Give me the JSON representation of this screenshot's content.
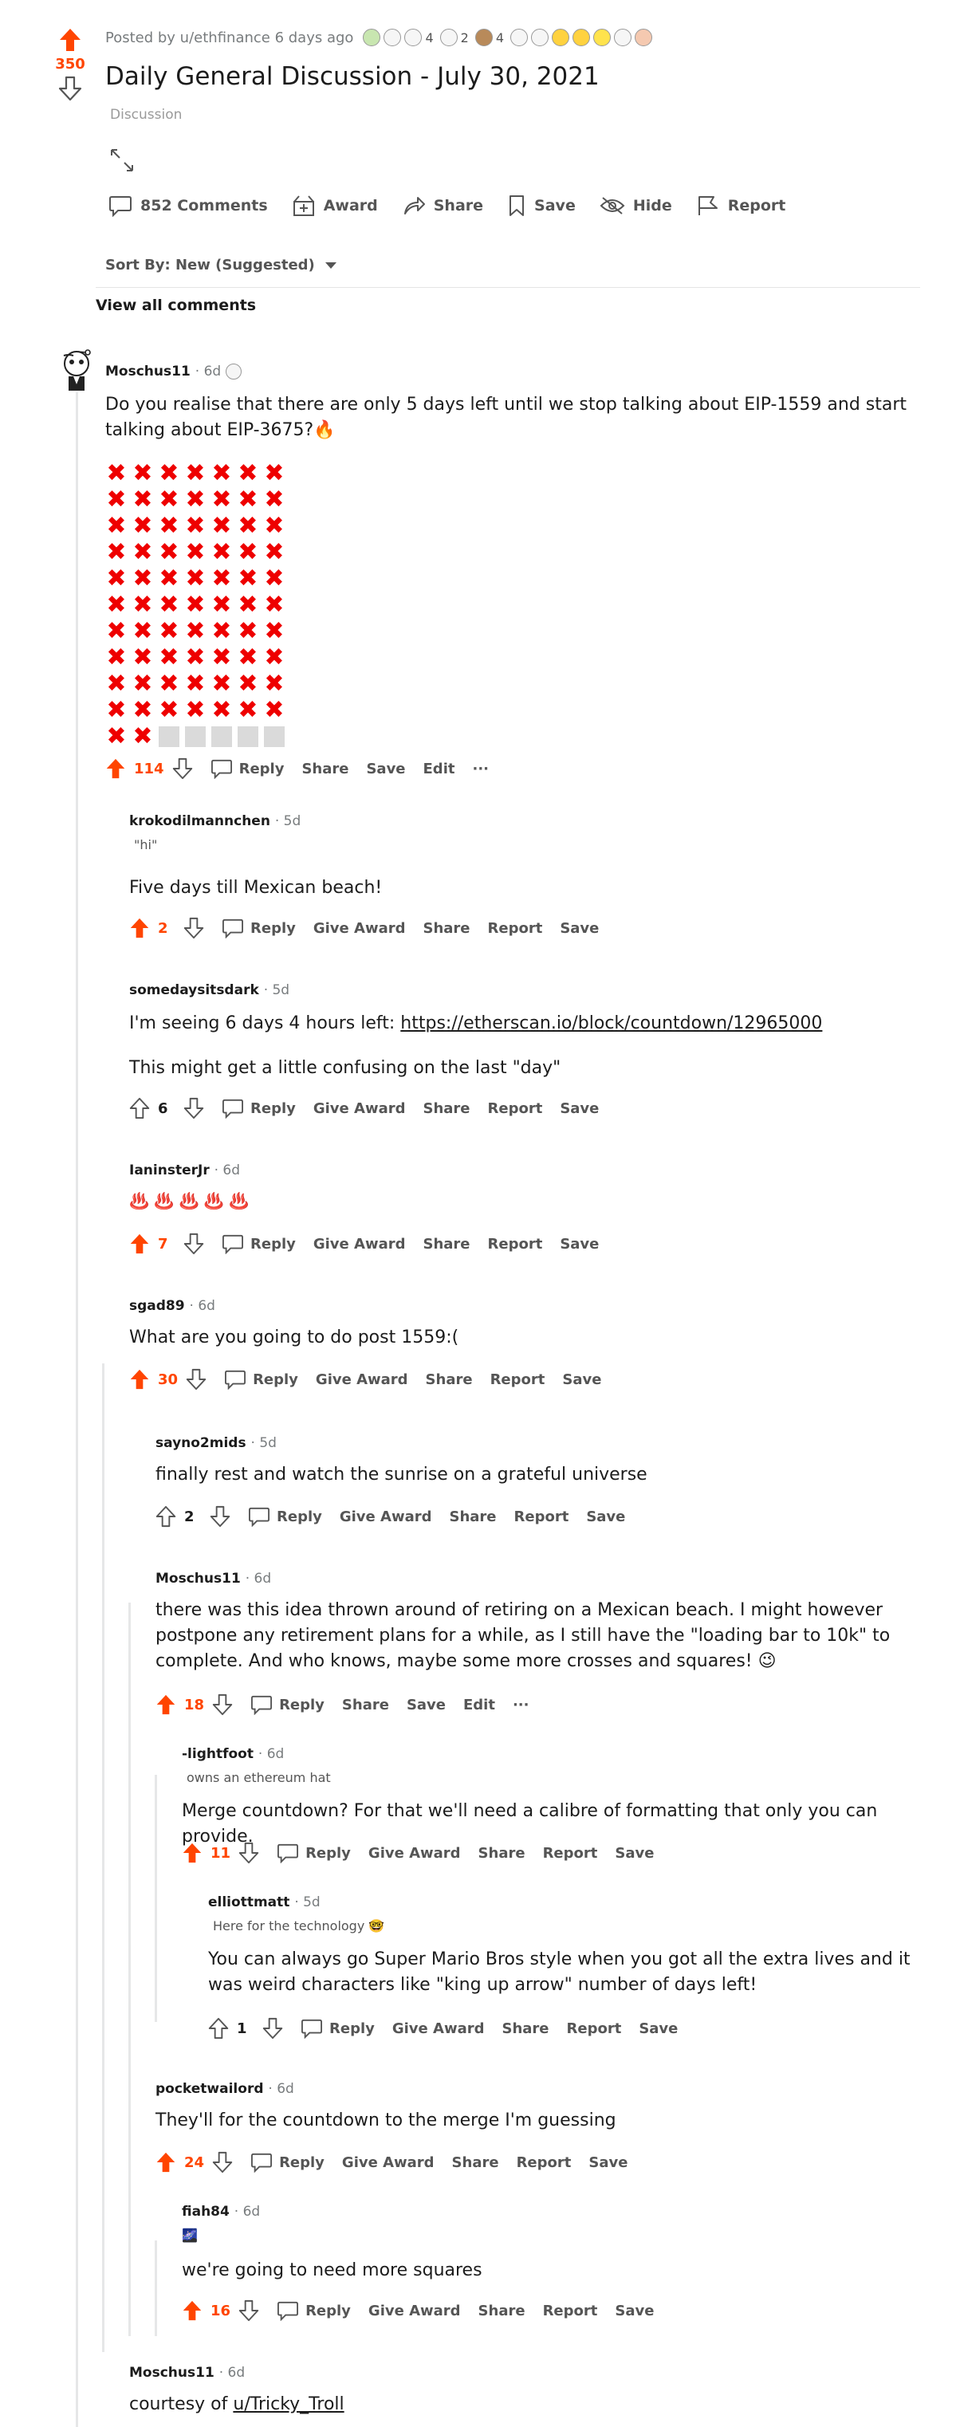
{
  "post": {
    "score": "350",
    "meta_prefix": "Posted by u/ethfinance 6 days ago",
    "award_counts": [
      "4",
      "2",
      "4"
    ],
    "title": "Daily General Discussion - July 30, 2021",
    "flair": "Discussion",
    "actions": {
      "comments": "852 Comments",
      "award": "Award",
      "share": "Share",
      "save": "Save",
      "hide": "Hide",
      "report": "Report"
    },
    "sort_label": "Sort By: New (Suggested)",
    "view_all": "View all comments"
  },
  "comments": [
    {
      "author": "Moschus11",
      "time": "· 6d",
      "body": "Do you realise that there are only 5 days left until we stop talking about EIP-1559 and start talking about EIP-3675?🔥",
      "score": "114",
      "actions": [
        "Reply",
        "Share",
        "Save",
        "Edit",
        "···"
      ]
    },
    {
      "author": "krokodilmannchen",
      "time": "· 5d",
      "flair": "\"hi\"",
      "body": "Five days till Mexican beach!",
      "score": "2",
      "actions": [
        "Reply",
        "Give Award",
        "Share",
        "Report",
        "Save"
      ]
    },
    {
      "author": "somedaysitsdark",
      "time": "· 5d",
      "body_prefix": "I'm seeing 6 days 4 hours left: ",
      "link": "https://etherscan.io/block/countdown/12965000",
      "body2": "This might get a little confusing on the last \"day\"",
      "score": "6",
      "actions": [
        "Reply",
        "Give Award",
        "Share",
        "Report",
        "Save"
      ]
    },
    {
      "author": "IaninsterJr",
      "time": "· 6d",
      "body": "♨️ ♨️ ♨️ ♨️ ♨️",
      "score": "7",
      "actions": [
        "Reply",
        "Give Award",
        "Share",
        "Report",
        "Save"
      ]
    },
    {
      "author": "sgad89",
      "time": "· 6d",
      "body": "What are you going to do post 1559:(",
      "score": "30",
      "actions": [
        "Reply",
        "Give Award",
        "Share",
        "Report",
        "Save"
      ]
    },
    {
      "author": "sayno2mids",
      "time": "· 5d",
      "body": "finally rest and watch the sunrise on a grateful universe",
      "score": "2",
      "actions": [
        "Reply",
        "Give Award",
        "Share",
        "Report",
        "Save"
      ]
    },
    {
      "author": "Moschus11",
      "time": "· 6d",
      "body": "there was this idea thrown around of retiring on a Mexican beach. I might however postpone any retirement plans for a while, as I still have the \"loading bar to 10k\" to complete. And who knows, maybe some more crosses and squares! 😉",
      "score": "18",
      "actions": [
        "Reply",
        "Share",
        "Save",
        "Edit",
        "···"
      ]
    },
    {
      "author": "-lightfoot",
      "time": "· 6d",
      "flair": "owns an ethereum hat",
      "body": "Merge countdown? For that we'll need a calibre of formatting that only you can provide.",
      "score": "11",
      "actions": [
        "Reply",
        "Give Award",
        "Share",
        "Report",
        "Save"
      ]
    },
    {
      "author": "elliottmatt",
      "time": "· 5d",
      "flair": "Here for the technology 🤓",
      "body": "You can always go Super Mario Bros style when you got all the extra lives and it was weird characters like \"king up arrow\" number of days left!",
      "score": "1",
      "actions": [
        "Reply",
        "Give Award",
        "Share",
        "Report",
        "Save"
      ]
    },
    {
      "author": "pocketwailord",
      "time": "· 6d",
      "body": "They'll for the countdown to the merge I'm guessing",
      "score": "24",
      "actions": [
        "Reply",
        "Give Award",
        "Share",
        "Report",
        "Save"
      ]
    },
    {
      "author": "fiah84",
      "time": "· 6d",
      "flair": "🌌",
      "body": "we're going to need more squares",
      "score": "16",
      "actions": [
        "Reply",
        "Give Award",
        "Share",
        "Report",
        "Save"
      ]
    },
    {
      "author": "Moschus11",
      "time": "· 6d",
      "body_prefix": "courtesy of ",
      "link": "u/Tricky_Troll"
    }
  ],
  "progress": {
    "crosses": 72,
    "squares": 5,
    "columns": 7
  },
  "colors": {
    "upvote": "#ff4500",
    "cross": "#e00000",
    "square": "#dadada",
    "thread": "#e6e7e8"
  }
}
